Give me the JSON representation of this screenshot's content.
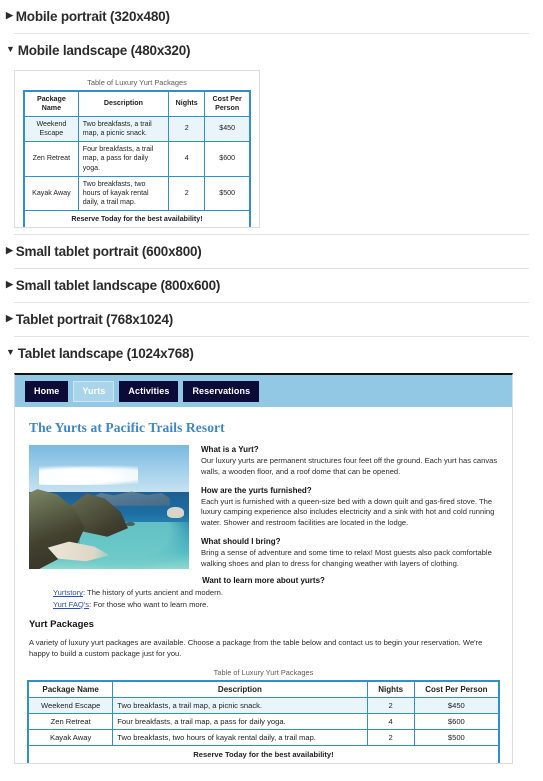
{
  "sections": [
    {
      "label": "Mobile portrait (320x480)",
      "expanded": false,
      "marker": "▶"
    },
    {
      "label": "Mobile landscape (480x320)",
      "expanded": true,
      "marker": "▼"
    },
    {
      "label": "Small tablet portrait (600x800)",
      "expanded": false,
      "marker": "▶"
    },
    {
      "label": "Small tablet landscape (800x600)",
      "expanded": false,
      "marker": "▶"
    },
    {
      "label": "Tablet portrait (768x1024)",
      "expanded": false,
      "marker": "▶"
    },
    {
      "label": "Tablet landscape (1024x768)",
      "expanded": true,
      "marker": "▼"
    }
  ],
  "nav": {
    "items": [
      {
        "label": "Home",
        "active": false
      },
      {
        "label": "Yurts",
        "active": true
      },
      {
        "label": "Activities",
        "active": false
      },
      {
        "label": "Reservations",
        "active": false
      }
    ]
  },
  "site": {
    "heading": "The Yurts at Pacific Trails Resort",
    "hero_image_alt": "coastal-cliffs-photo",
    "faq": [
      {
        "question": "What is a Yurt?",
        "answer": "Our luxury yurts are permanent structures four feet off the ground. Each yurt has canvas walls, a wooden floor, and a roof dome that can be opened."
      },
      {
        "question": "How are the yurts furnished?",
        "answer": "Each yurt is furnished with a queen-size bed with a down quilt and gas-fired stove. The luxury camping experience also includes electricity and a sink with hot and cold running water. Shower and restroom facilities are located in the lodge."
      },
      {
        "question": "What should I bring?",
        "answer": "Bring a sense of adventure and some time to relax! Most guests also pack comfortable walking shoes and plan to dress for changing weather with layers of clothing."
      }
    ],
    "learn_more_heading": "Want to learn more about yurts?",
    "links": [
      {
        "text": "Yurtstory",
        "description": ": The history of yurts ancient and modern."
      },
      {
        "text": "Yurt FAQ's",
        "description": ": For those who want to learn more."
      }
    ],
    "packages_heading": "Yurt Packages",
    "packages_intro": "A variety of luxury yurt packages are available. Choose a package from the table below and contact us to begin your reservation. We're happy to build a custom package just for you."
  },
  "table": {
    "caption": "Table of Luxury Yurt Packages",
    "headers": [
      "Package Name",
      "Description",
      "Nights",
      "Cost Per Person"
    ],
    "rows": [
      {
        "name": "Weekend Escape",
        "description": "Two breakfasts, a trail map, a picnic snack.",
        "nights": "2",
        "cost": "$450"
      },
      {
        "name": "Zen Retreat",
        "description": "Four breakfasts, a trail map, a pass for daily yoga.",
        "nights": "4",
        "cost": "$600"
      },
      {
        "name": "Kayak Away",
        "description": "Two breakfasts, two hours of kayak rental daily, a trail map.",
        "nights": "2",
        "cost": "$500"
      }
    ],
    "footer": "Reserve Today for the best availability!"
  },
  "colors": {
    "nav_bar_bg": "#92c8e3",
    "nav_button_bg": "#0c0b38",
    "nav_active_bg": "#a9d5ea",
    "heading_blue": "#3f86c4",
    "table_border": "#2e91c9",
    "row_alt_bg": "#eaf5fb",
    "link_blue": "#2d4fb0"
  }
}
